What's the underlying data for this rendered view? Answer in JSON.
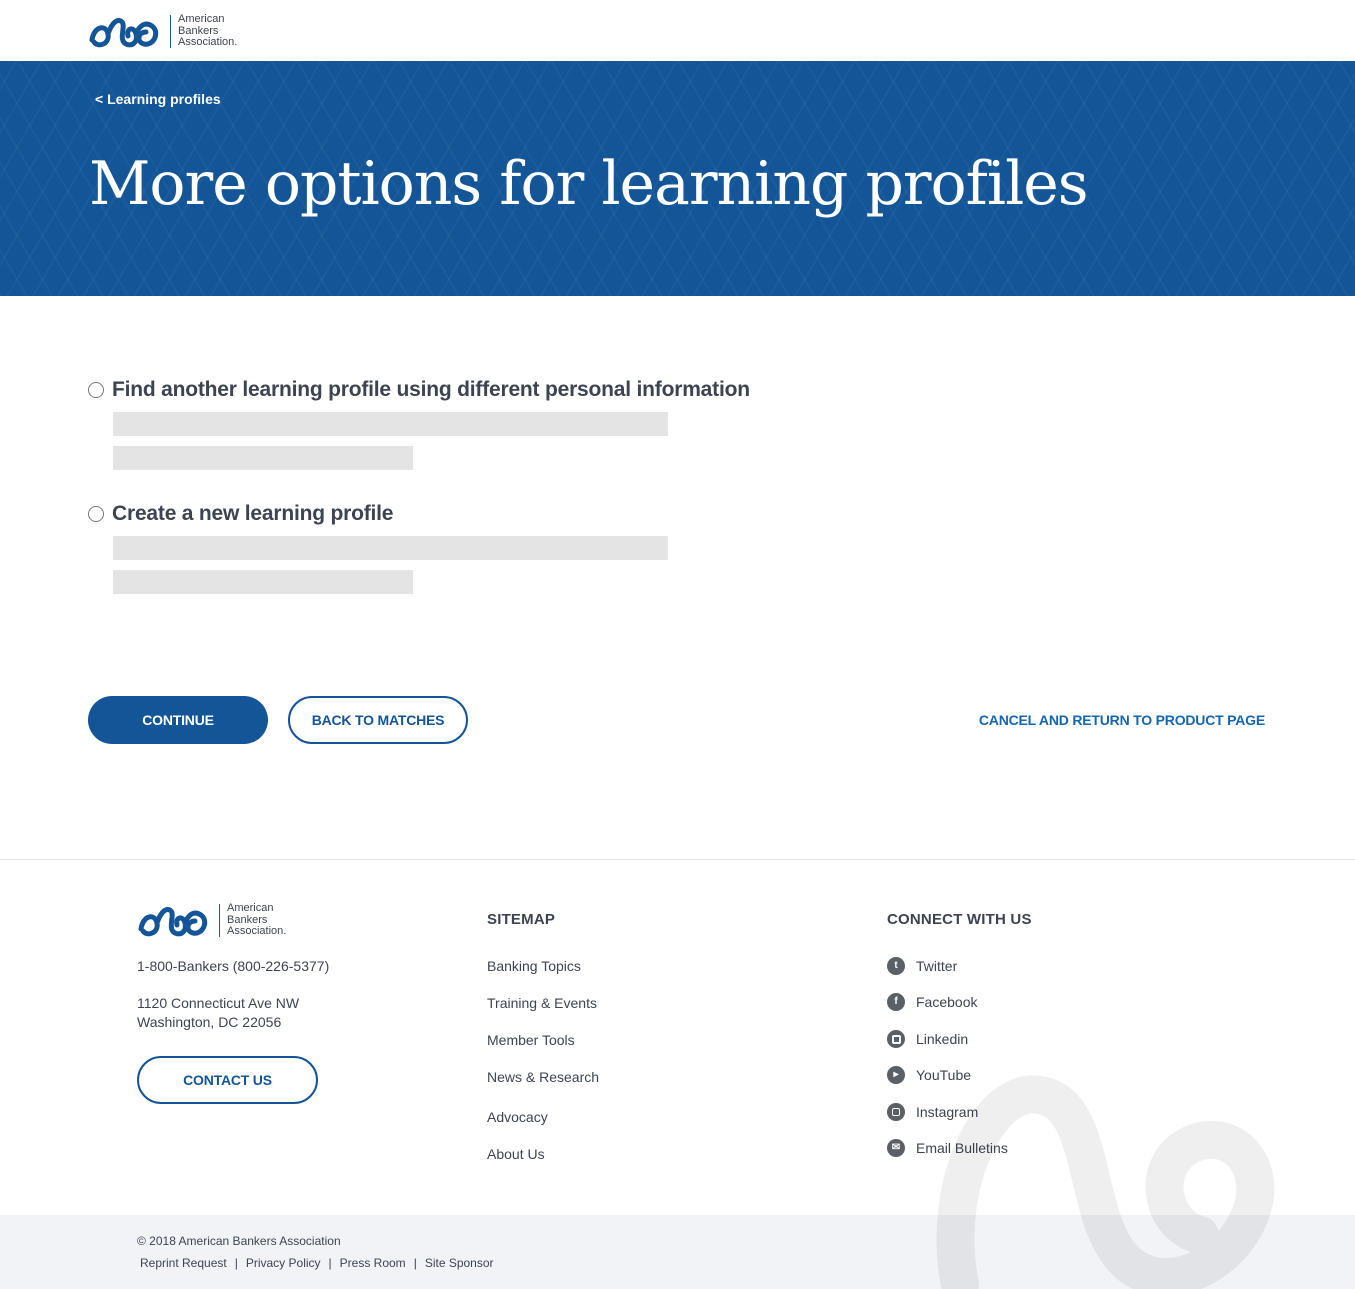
{
  "brand": {
    "name_line1": "American",
    "name_line2": "Bankers",
    "name_line3": "Association.",
    "primary_color": "#135597",
    "link_color": "#1566b0",
    "text_color": "#3d4450"
  },
  "hero": {
    "breadcrumb": "< Learning profiles",
    "title": "More options for learning profiles"
  },
  "options": [
    {
      "label": "Find another learning profile using different personal information",
      "selected": false
    },
    {
      "label": "Create a new learning profile",
      "selected": false
    }
  ],
  "actions": {
    "continue": "CONTINUE",
    "back": "BACK TO MATCHES",
    "cancel": "CANCEL AND RETURN TO PRODUCT PAGE"
  },
  "footer": {
    "phone": "1-800-Bankers (800-226-5377)",
    "address_line1": "1120 Connecticut Ave NW",
    "address_line2": "Washington, DC 22056",
    "contact_button": "CONTACT US",
    "sitemap": {
      "heading": "SITEMAP",
      "links": [
        "Banking Topics",
        "Training & Events",
        "Member Tools",
        "News & Research",
        "Advocacy",
        "About Us"
      ]
    },
    "connect": {
      "heading": "CONNECT WITH US",
      "links": [
        {
          "label": "Twitter",
          "icon": "twitter-icon"
        },
        {
          "label": "Facebook",
          "icon": "facebook-icon"
        },
        {
          "label": "Linkedin",
          "icon": "linkedin-icon"
        },
        {
          "label": "YouTube",
          "icon": "youtube-icon"
        },
        {
          "label": "Instagram",
          "icon": "instagram-icon"
        },
        {
          "label": "Email Bulletins",
          "icon": "email-icon"
        }
      ]
    },
    "copyright": "© 2018 American Bankers Association",
    "legal": [
      "Reprint Request",
      "Privacy Policy",
      "Press Room",
      "Site Sponsor"
    ]
  }
}
